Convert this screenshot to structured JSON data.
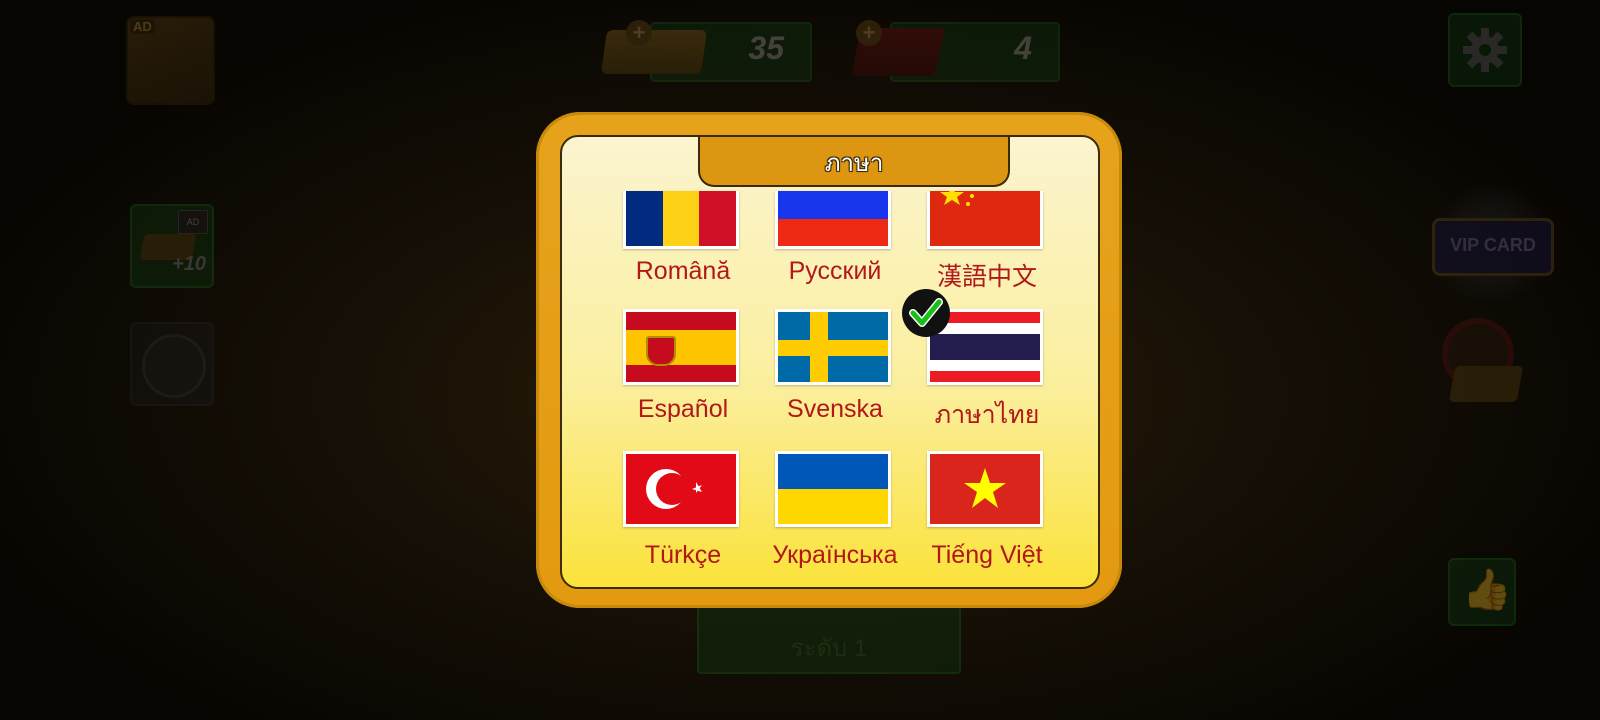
{
  "hud": {
    "ad_badge": "AD",
    "gold_count": "35",
    "ruby_count": "4",
    "plus": "+",
    "bonus_reward": "+10",
    "bonus_ad": "AD",
    "vip_label": "VIP CARD",
    "level_label": "ระดับ 1"
  },
  "dialog": {
    "title": "ภาษา",
    "selected": "ภาษาไทย",
    "languages": [
      {
        "label": "Română",
        "flag": "romania"
      },
      {
        "label": "Русский",
        "flag": "russia"
      },
      {
        "label": "漢語中文",
        "flag": "china"
      },
      {
        "label": "Español",
        "flag": "spain"
      },
      {
        "label": "Svenska",
        "flag": "sweden"
      },
      {
        "label": "ภาษาไทย",
        "flag": "thailand"
      },
      {
        "label": "Türkçe",
        "flag": "turkey"
      },
      {
        "label": "Українська",
        "flag": "ukraine"
      },
      {
        "label": "Tiếng Việt",
        "flag": "vietnam"
      }
    ]
  },
  "colors": {
    "modal_frame": "#e39a10",
    "label_text": "#b2181a",
    "check_mark": "#18c018"
  }
}
